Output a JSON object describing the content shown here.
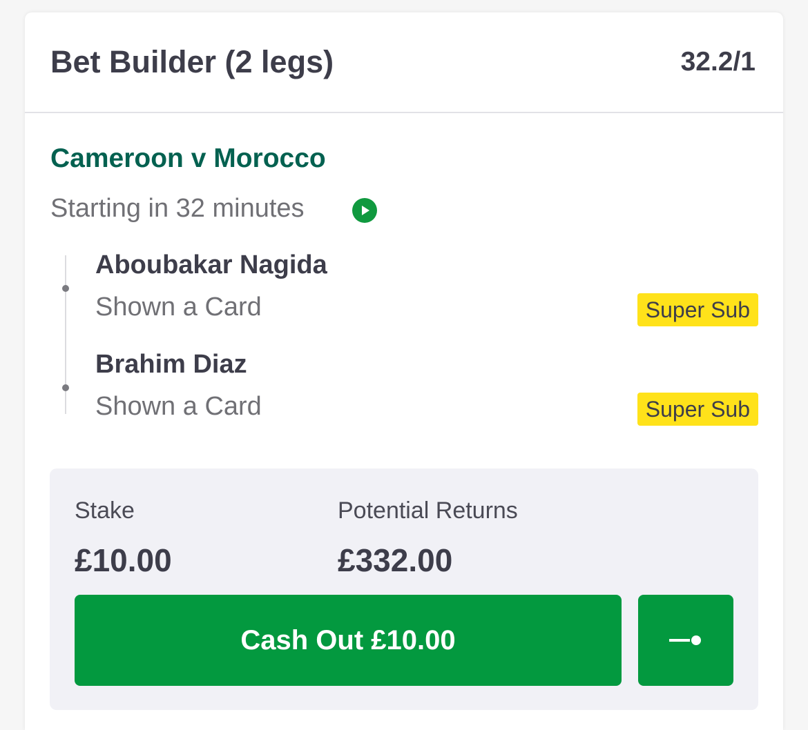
{
  "header": {
    "title": "Bet Builder (2 legs)",
    "odds": "32.2/1"
  },
  "event": {
    "name": "Cameroon v Morocco",
    "status": "Starting in 32 minutes",
    "status_icon": "play-circle-icon"
  },
  "legs": [
    {
      "player": "Aboubakar Nagida",
      "market": "Shown a Card",
      "badge": "Super Sub"
    },
    {
      "player": "Brahim Diaz",
      "market": "Shown a Card",
      "badge": "Super Sub"
    }
  ],
  "bet": {
    "stake_label": "Stake",
    "stake_value": "£10.00",
    "returns_label": "Potential Returns",
    "returns_value": "£332.00"
  },
  "actions": {
    "cashout_label": "Cash Out £10.00",
    "partial_cashout_icon": "slider-icon"
  },
  "colors": {
    "brand_green": "#03993f",
    "event_green": "#046150",
    "badge_yellow": "#ffe21a",
    "text_dark": "#3d3d4a"
  }
}
